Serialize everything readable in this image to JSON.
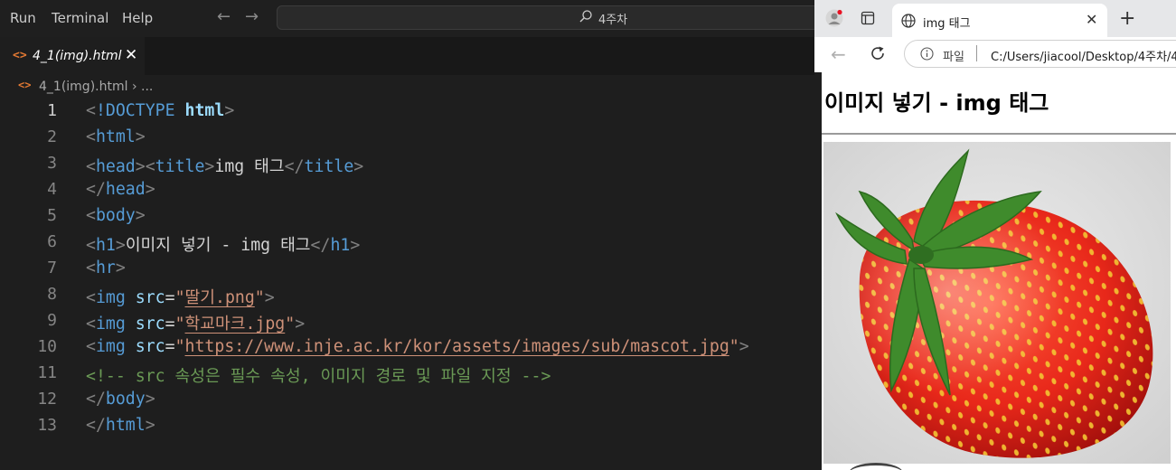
{
  "menu": {
    "run": "Run",
    "terminal": "Terminal",
    "help": "Help"
  },
  "command_center": {
    "text": "4주차",
    "icon": "search-icon"
  },
  "editor_tab": {
    "label": "4_1(img).html",
    "icon": "html-file-icon"
  },
  "breadcrumb": {
    "file": "4_1(img).html",
    "rest": "› ..."
  },
  "lines": [
    {
      "n": "1"
    },
    {
      "n": "2"
    },
    {
      "n": "3"
    },
    {
      "n": "4"
    },
    {
      "n": "5"
    },
    {
      "n": "6"
    },
    {
      "n": "7"
    },
    {
      "n": "8"
    },
    {
      "n": "9"
    },
    {
      "n": "10"
    },
    {
      "n": "11"
    },
    {
      "n": "12"
    },
    {
      "n": "13"
    }
  ],
  "code": {
    "doctype": "!DOCTYPE",
    "html_kw": "html",
    "html": "html",
    "head": "head",
    "title": "title",
    "title_text": "img 태그",
    "body": "body",
    "h1": "h1",
    "h1_text": "이미지 넣기 - img 태그",
    "hr": "hr",
    "img": "img",
    "src": "src",
    "src1": "딸기.png",
    "src2": "학교마크.jpg",
    "src3": "https://www.inje.ac.kr/kor/assets/images/sub/mascot.jpg",
    "comment": "<!-- src 속성은 필수 속성, 이미지 경로 및 파일 지정 -->"
  },
  "browser": {
    "tab_title": "img 태그",
    "scheme_label": "파일",
    "url": "C:/Users/jiacool/Desktop/4주차/4",
    "page_heading": "이미지 넣기 - img 태그"
  },
  "colors": {
    "editor_bg": "#1e1e1e",
    "tag": "#569cd6",
    "attr": "#9cdcfe",
    "string": "#ce9178",
    "comment": "#6a9955",
    "html_icon": "#e37933"
  }
}
